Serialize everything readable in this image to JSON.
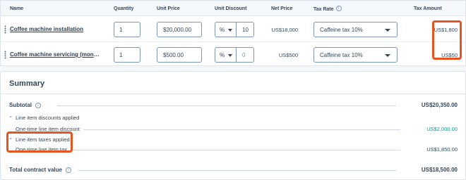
{
  "table": {
    "headers": {
      "name": "Name",
      "quantity": "Quantity",
      "unit_price": "Unit Price",
      "unit_discount": "Unit Discount",
      "net_price": "Net Price",
      "tax_rate": "Tax Rate",
      "tax_amount": "Tax Amount"
    },
    "rows": [
      {
        "name": "Coffee machine installation",
        "quantity": "1",
        "unit_price": "$20,000.00",
        "discount_type": "%",
        "discount_value": "10",
        "net_price": "US$18,000",
        "tax_rate": "Caffeine tax 10%",
        "tax_amount": "US$1,800"
      },
      {
        "name": "Coffee machine servicing (mont…",
        "quantity": "1",
        "unit_price": "$500.00",
        "discount_type": "%",
        "discount_value": "0",
        "net_price": "US$500",
        "tax_rate": "Caffeine tax 10%",
        "tax_amount": "US$50"
      }
    ]
  },
  "summary": {
    "title": "Summary",
    "subtotal_label": "Subtotal",
    "subtotal_value": "US$20,350.00",
    "discounts_group": "Line item discounts applied",
    "onetime_discount_label": "One-time line item discount",
    "onetime_discount_value": "US$2,000.00",
    "taxes_group": "Line item taxes applied",
    "onetime_tax_label": "One-time line item tax",
    "onetime_tax_value": "US$1,850.00",
    "total_label": "Total contract value",
    "total_value": "US$18,500.00"
  },
  "colors": {
    "highlight": "#e6541f",
    "discount_green": "#00a38d"
  },
  "icons": [
    "drag-handle-icon",
    "caret-down-icon",
    "info-icon",
    "chevron-down-icon"
  ]
}
